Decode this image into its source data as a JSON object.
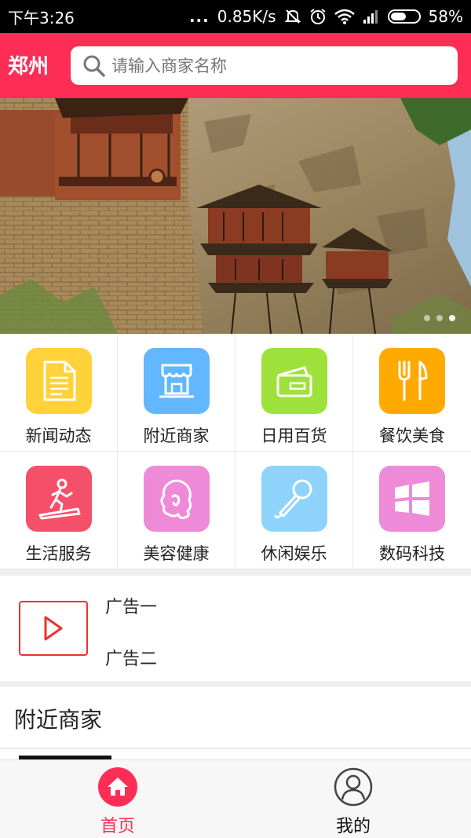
{
  "status_bar": {
    "time": "下午3:26",
    "dots": "...",
    "network_speed": "0.85K/s",
    "battery_percent": "58%",
    "battery_level": 0.58,
    "icons": [
      "mute-icon",
      "alarm-icon",
      "wifi-icon",
      "signal-icon",
      "battery-icon"
    ]
  },
  "header": {
    "city": "郑州",
    "search_placeholder": "请输入商家名称",
    "search_value": ""
  },
  "banner": {
    "slides_count": 3,
    "active_slide": 2
  },
  "categories": [
    {
      "label": "新闻动态",
      "icon": "document-icon",
      "color": "#ffd23a"
    },
    {
      "label": "附近商家",
      "icon": "shop-icon",
      "color": "#63b7ff"
    },
    {
      "label": "日用百货",
      "icon": "card-icon",
      "color": "#9ee13b"
    },
    {
      "label": "餐饮美食",
      "icon": "fork-knife-icon",
      "color": "#ffaa00"
    },
    {
      "label": "生活服务",
      "icon": "treadmill-icon",
      "color": "#f4506a"
    },
    {
      "label": "美容健康",
      "icon": "woman-face-icon",
      "color": "#ee8ad8"
    },
    {
      "label": "休闲娱乐",
      "icon": "microphone-icon",
      "color": "#8ed3fb"
    },
    {
      "label": "数码科技",
      "icon": "windows-icon",
      "color": "#ef8ad8"
    }
  ],
  "ads": {
    "line1": "广告一",
    "line2": "广告二",
    "icon": "play-icon",
    "accent": "#e8332b"
  },
  "nearby": {
    "title": "附近商家"
  },
  "bottom_nav": {
    "home_label": "首页",
    "mine_label": "我的",
    "active": "home",
    "accent": "#fe2d55"
  },
  "theme": {
    "header_color": "#fe2d55"
  }
}
